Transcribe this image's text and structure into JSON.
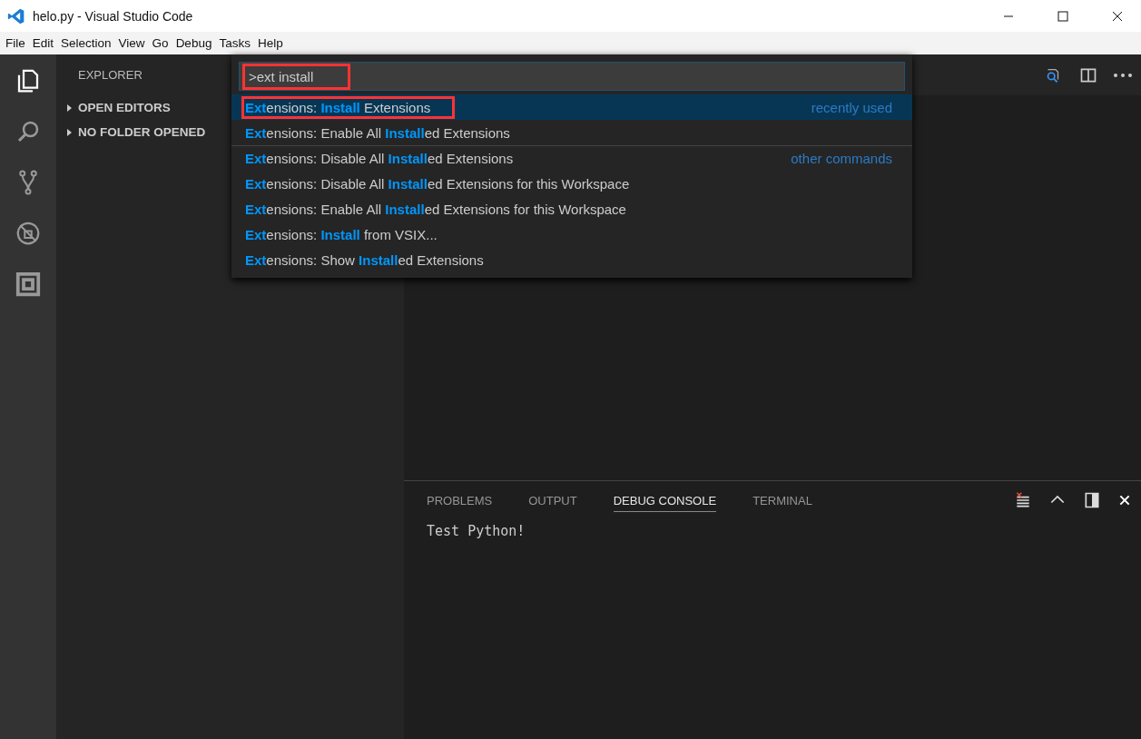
{
  "window": {
    "title": "helo.py - Visual Studio Code"
  },
  "menu": [
    "File",
    "Edit",
    "Selection",
    "View",
    "Go",
    "Debug",
    "Tasks",
    "Help"
  ],
  "sidebar": {
    "title": "EXPLORER",
    "sections": [
      {
        "label": "OPEN EDITORS",
        "expanded": false
      },
      {
        "label": "NO FOLDER OPENED",
        "expanded": false
      }
    ]
  },
  "command_palette": {
    "value": ">ext install",
    "annotated": true,
    "items": [
      {
        "label": "**Ext**ensions: **Install** Extensions",
        "selected": true,
        "annotated": true,
        "group": "recently used",
        "separator": false
      },
      {
        "label": "**Ext**ensions: Enable All **Install**ed Extensions",
        "selected": false,
        "annotated": false,
        "separator": false
      },
      {
        "label": "**Ext**ensions: Disable All **Install**ed Extensions",
        "selected": false,
        "annotated": false,
        "group": "other commands",
        "separator": true
      },
      {
        "label": "**Ext**ensions: Disable All **Install**ed Extensions for this Workspace",
        "selected": false,
        "annotated": false,
        "separator": false
      },
      {
        "label": "**Ext**ensions: Enable All **Install**ed Extensions for this Workspace",
        "selected": false,
        "annotated": false,
        "separator": false
      },
      {
        "label": "**Ext**ensions: **Install** from VSIX...",
        "selected": false,
        "annotated": false,
        "separator": false
      },
      {
        "label": "**Ext**ensions: Show **Install**ed Extensions",
        "selected": false,
        "annotated": false,
        "separator": false
      }
    ]
  },
  "panel": {
    "tabs": [
      {
        "label": "PROBLEMS",
        "selected": false
      },
      {
        "label": "OUTPUT",
        "selected": false
      },
      {
        "label": "DEBUG CONSOLE",
        "selected": true
      },
      {
        "label": "TERMINAL",
        "selected": false
      }
    ],
    "output": "Test Python!"
  }
}
